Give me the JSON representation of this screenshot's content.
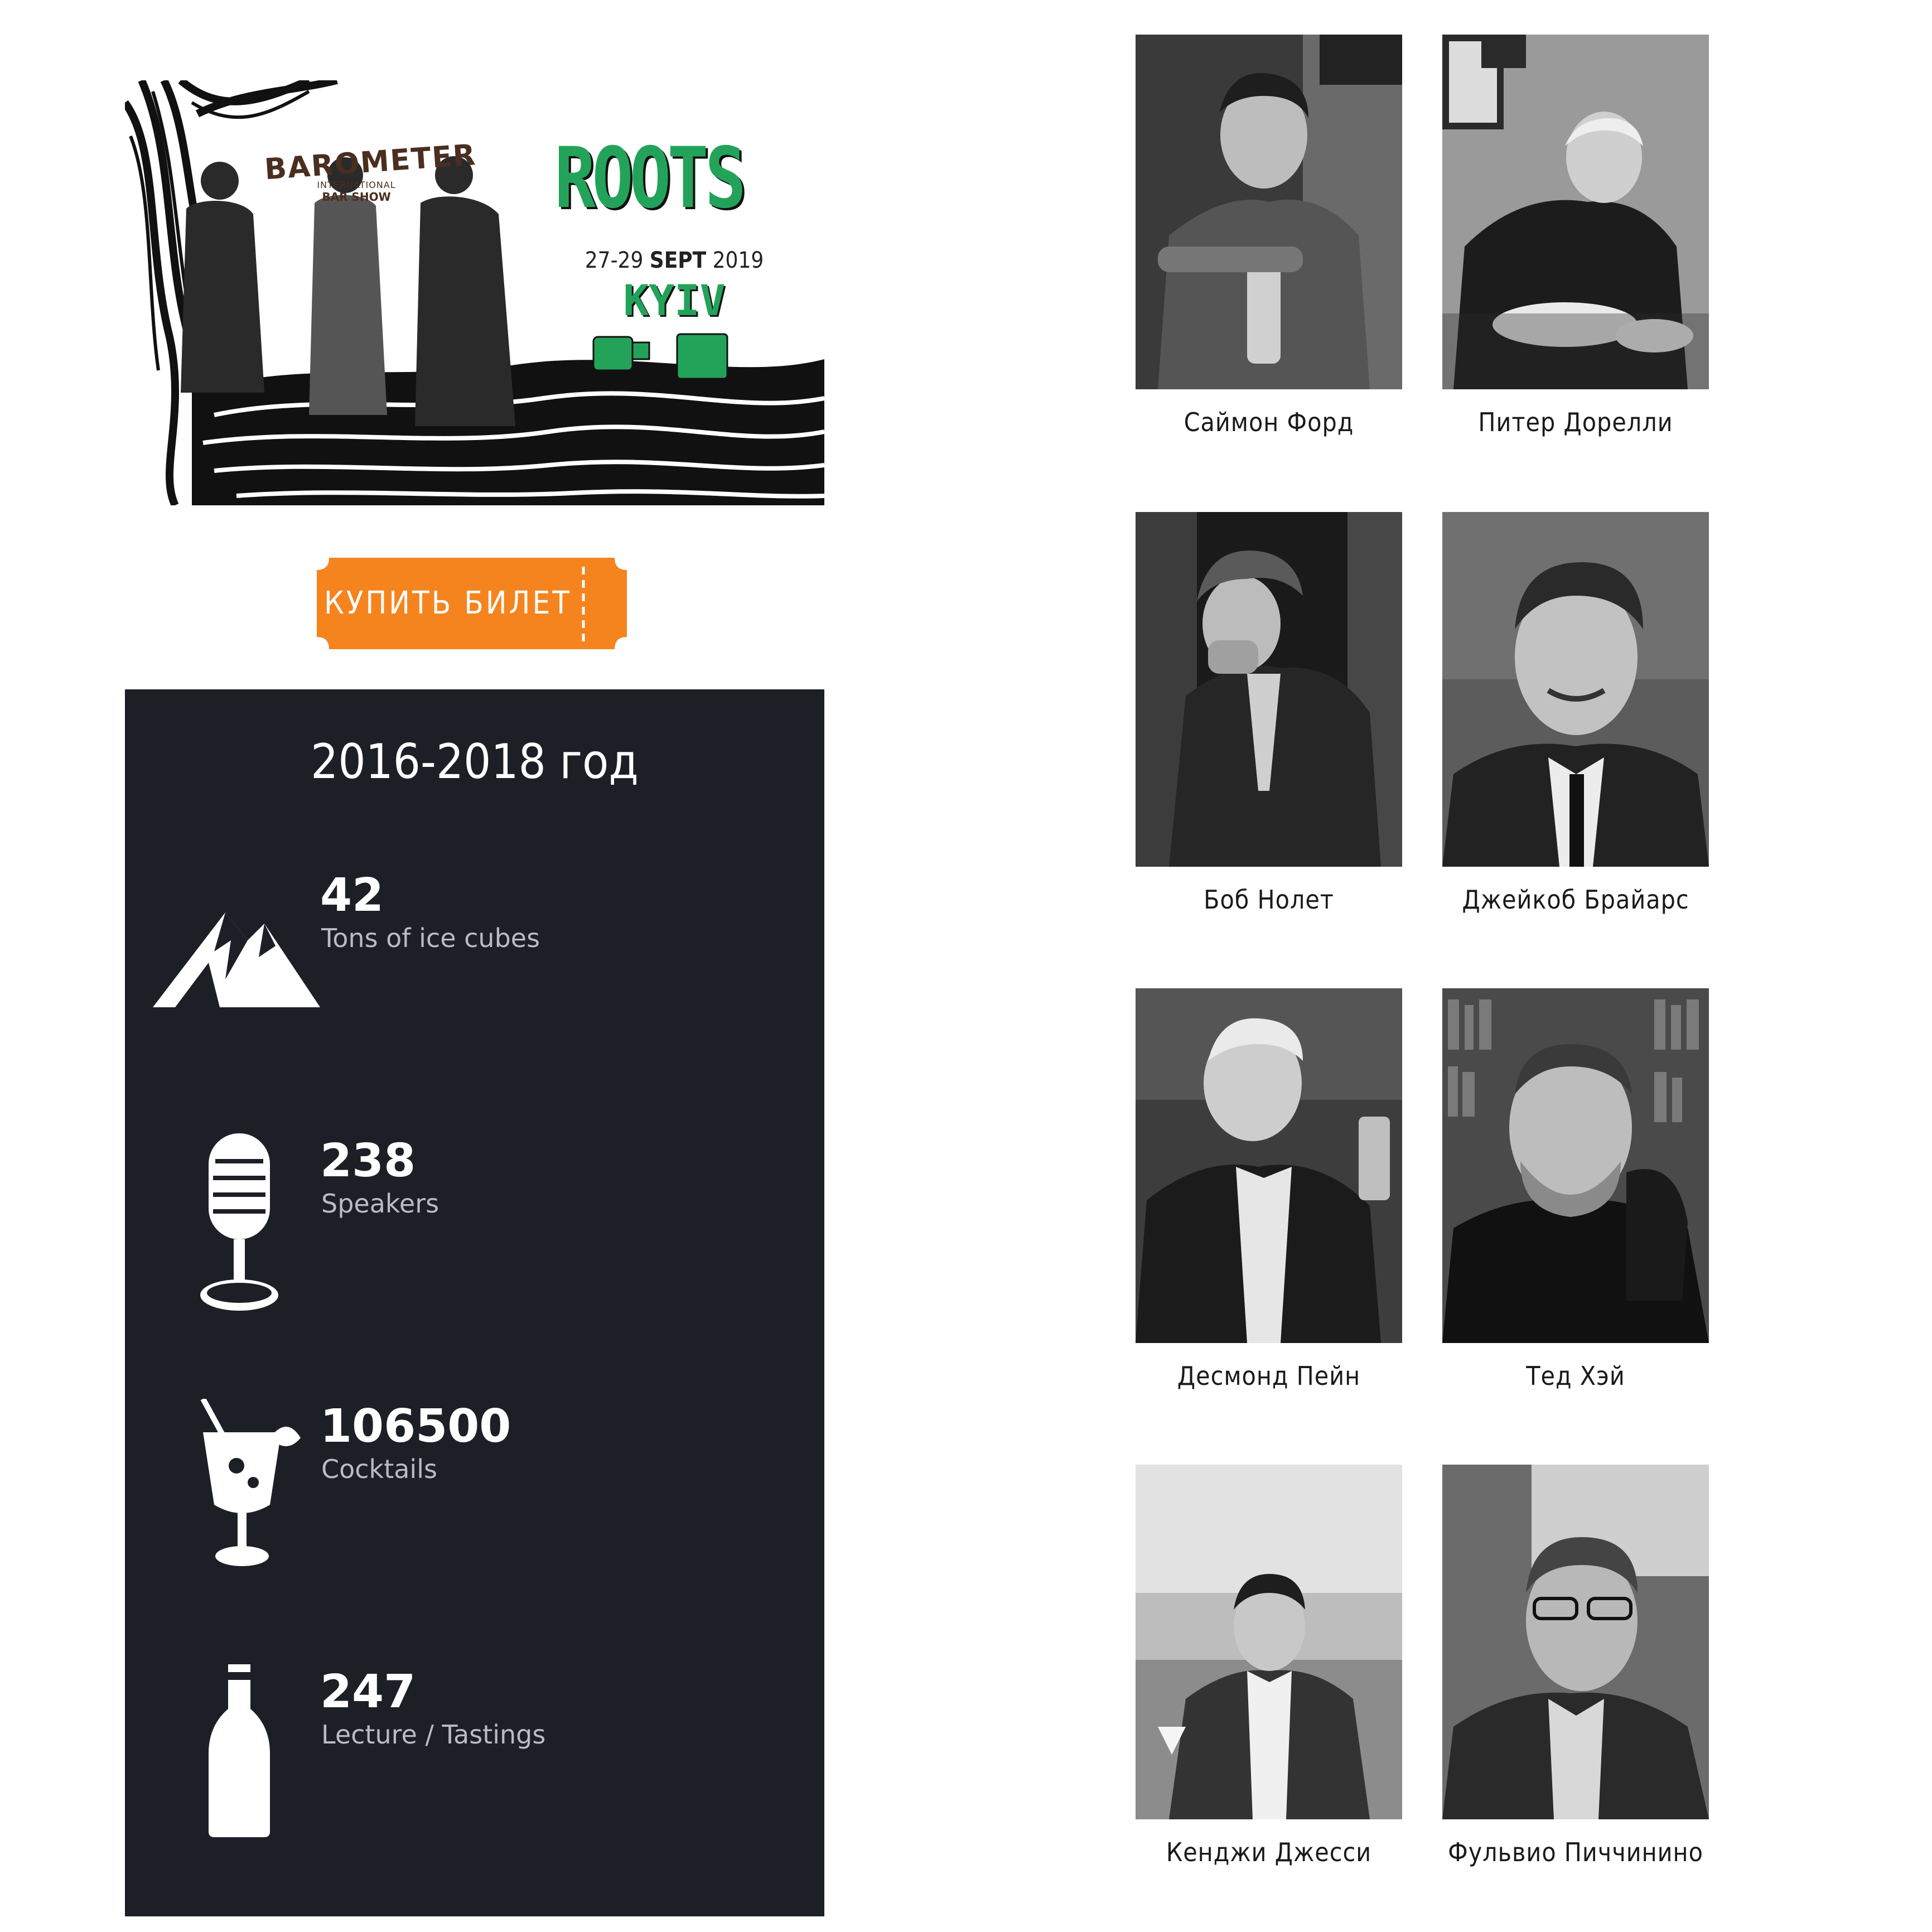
{
  "banner": {
    "brand_main": "BAROMETER",
    "brand_sub": "INTERNATIONAL",
    "brand_sub2": "BAR SHOW",
    "event_title": "ROOTS",
    "dates_plain": "27-29",
    "dates_bold": "SEPT",
    "year": "2019",
    "city": "KYIV",
    "accent_color": "#23a35a"
  },
  "ticket": {
    "label": "КУПИТЬ БИЛЕТ",
    "color": "#f5841f"
  },
  "stats": {
    "title": "2016-2018 год",
    "items": [
      {
        "value": "42",
        "label": "Tons of ice cubes",
        "icon": "mountain-icon"
      },
      {
        "value": "238",
        "label": "Speakers",
        "icon": "microphone-icon"
      },
      {
        "value": "106500",
        "label": "Cocktails",
        "icon": "cocktail-icon"
      },
      {
        "value": "247",
        "label": "Lecture / Tastings",
        "icon": "bottle-icon"
      }
    ]
  },
  "speakers": [
    {
      "name": "Саймон Форд"
    },
    {
      "name": "Питер Дорелли"
    },
    {
      "name": "Боб Нолет"
    },
    {
      "name": "Джейкоб Брайарс"
    },
    {
      "name": "Десмонд Пейн"
    },
    {
      "name": "Тед Хэй"
    },
    {
      "name": "Кенджи Джесси"
    },
    {
      "name": "Фульвио Пиччинино"
    }
  ]
}
